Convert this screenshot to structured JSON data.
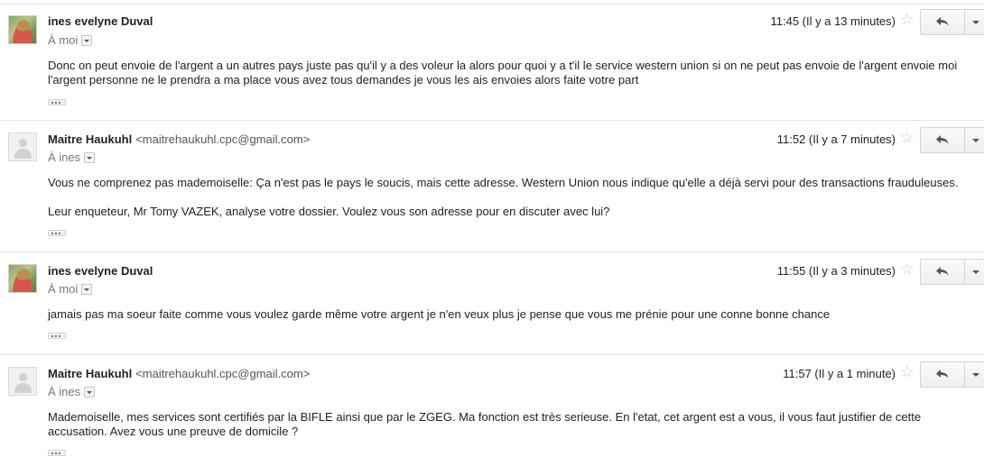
{
  "messages": [
    {
      "sender_name": "ines evelyne Duval",
      "sender_email": "",
      "recipient": "À moi",
      "time": "11:45 (Il y a 13 minutes)",
      "body": [
        "Donc on peut envoie de l'argent a un autres pays juste pas qu'il y a des voleur la alors pour quoi y a t'il le service western union si on ne peut pas envoie de l'argent envoie moi l'argent personne ne le prendra a ma place vous avez tous demandes je vous les ais envoies alors faite votre part"
      ]
    },
    {
      "sender_name": "Maitre Haukuhl",
      "sender_email": "<maitrehaukuhl.cpc@gmail.com>",
      "recipient": "À ines",
      "time": "11:52 (Il y a 7 minutes)",
      "body": [
        "Vous ne comprenez pas mademoiselle: Ça n'est pas le pays le soucis, mais cette adresse. Western Union nous indique qu'elle a déjà servi pour des transactions frauduleuses.",
        "Leur enqueteur, Mr Tomy VAZEK, analyse votre dossier. Voulez vous son adresse pour en discuter avec lui?"
      ]
    },
    {
      "sender_name": "ines evelyne Duval",
      "sender_email": "",
      "recipient": "À moi",
      "time": "11:55 (Il y a 3 minutes)",
      "body": [
        "jamais pas ma soeur faite comme vous voulez garde même votre argent je n'en veux plus je pense que vous me prénie pour une conne bonne chance"
      ]
    },
    {
      "sender_name": "Maitre Haukuhl",
      "sender_email": "<maitrehaukuhl.cpc@gmail.com>",
      "recipient": "À ines",
      "time": "11:57 (Il y a 1 minute)",
      "body": [
        "Mademoiselle, mes services sont certifiés par la BIFLE ainsi que par le ZGEG. Ma fonction est très serieuse. En l'etat, cet argent est a vous, il vous faut justifier de cette accusation. Avez vous une preuve de domicile ?"
      ]
    }
  ],
  "icons": {
    "star": "star-outline-icon",
    "reply": "reply-arrow-icon",
    "more": "chevron-down-icon",
    "show_trimmed": "ellipsis-icon"
  },
  "colors": {
    "text": "#222222",
    "secondary_text": "#777777",
    "divider": "#e5e5e5",
    "star": "#c9c9c9"
  }
}
